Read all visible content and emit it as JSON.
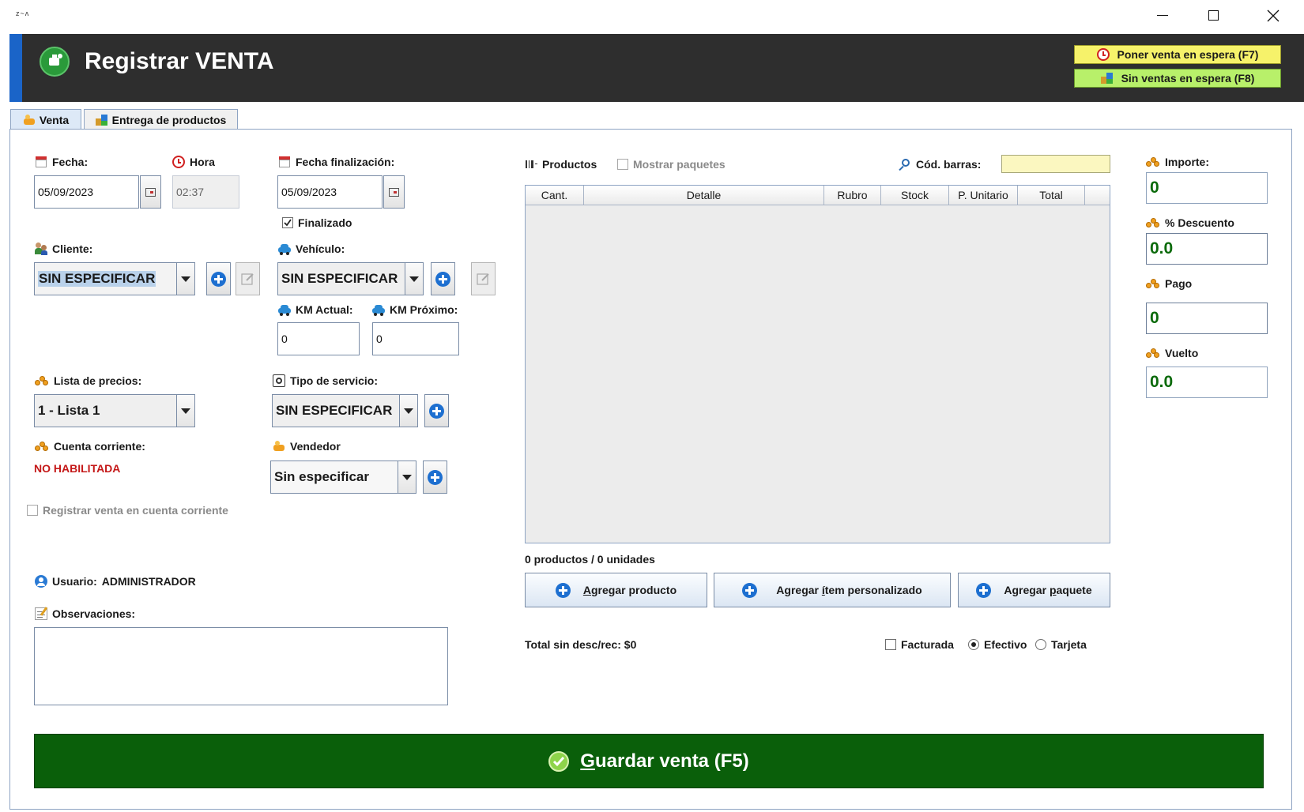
{
  "window": {
    "title": "",
    "logo_text": "ᴢ~ᴧ",
    "controls": {
      "minimize": "minimize-icon",
      "maximize": "maximize-icon",
      "close": "close-icon"
    }
  },
  "header": {
    "title": "Registrar VENTA",
    "hold_button_label": "Poner venta en espera (F7)",
    "no_hold_button_label": "Sin ventas en espera (F8)",
    "colors": {
      "bar": "#2e2e2e",
      "accent": "#1a64c8",
      "hold_button_bg": "#f6f26a",
      "no_hold_button_bg": "#b8f06a"
    }
  },
  "tabs": [
    {
      "label": "Venta",
      "active": true
    },
    {
      "label": "Entrega de productos",
      "active": false
    }
  ],
  "form": {
    "fecha": {
      "label": "Fecha:",
      "value": "05/09/2023"
    },
    "hora": {
      "label": "Hora",
      "value": "02:37"
    },
    "fecha_fin": {
      "label": "Fecha finalización:",
      "value": "05/09/2023"
    },
    "finalizado": {
      "label": "Finalizado",
      "checked": true
    },
    "cliente": {
      "label": "Cliente:",
      "value": "SIN ESPECIFICAR"
    },
    "vehiculo": {
      "label": "Vehículo:",
      "value": "SIN ESPECIFICAR"
    },
    "km_actual": {
      "label": "KM Actual:",
      "value": "0"
    },
    "km_proximo": {
      "label": "KM Próximo:",
      "value": "0"
    },
    "lista_precios": {
      "label": "Lista de precios:",
      "value": "1 - Lista 1"
    },
    "tipo_servicio": {
      "label": "Tipo de servicio:",
      "value": "SIN ESPECIFICAR"
    },
    "cuenta_corriente": {
      "label": "Cuenta corriente:",
      "value": "NO HABILITADA",
      "color": "#c41818"
    },
    "vendedor": {
      "label": "Vendedor",
      "value": "Sin especificar"
    },
    "registrar_cc": {
      "label": "Registrar venta en cuenta corriente",
      "checked": false
    },
    "usuario": {
      "label": "Usuario:",
      "value": "ADMINISTRADOR"
    },
    "observaciones": {
      "label": "Observaciones:",
      "value": ""
    }
  },
  "products": {
    "label": "Productos",
    "mostrar_paquetes": "Mostrar paquetes",
    "barcode_label": "Cód. barras:",
    "barcode_value": "",
    "columns": [
      "Cant.",
      "Detalle",
      "Rubro",
      "Stock",
      "P. Unitario",
      "Total"
    ],
    "rows": [],
    "summary": "0 productos / 0 unidades",
    "buttons": {
      "agregar_producto": {
        "pre": "",
        "mnemonic": "A",
        "post": "gregar producto"
      },
      "agregar_item": {
        "pre": "Agregar ",
        "mnemonic": "í",
        "post": "tem personalizado"
      },
      "agregar_paquete": {
        "pre": "Agregar ",
        "mnemonic": "p",
        "post": "aquete"
      }
    },
    "total_sin_desc": "Total sin desc/rec: $0",
    "facturada": {
      "label": "Facturada",
      "checked": false
    },
    "payment": [
      {
        "label": "Efectivo",
        "selected": true
      },
      {
        "label": "Tarjeta",
        "selected": false
      }
    ]
  },
  "totals": {
    "importe": {
      "label": "Importe:",
      "value": "0"
    },
    "descuento": {
      "label": "% Descuento",
      "value": "0.0"
    },
    "pago": {
      "label": "Pago",
      "value": "0"
    },
    "vuelto": {
      "label": "Vuelto",
      "value": "0.0"
    },
    "value_color": "#0b6a0b"
  },
  "save": {
    "mnemonic": "G",
    "rest": "uardar venta (F5)",
    "color": "#0a5f0a"
  }
}
